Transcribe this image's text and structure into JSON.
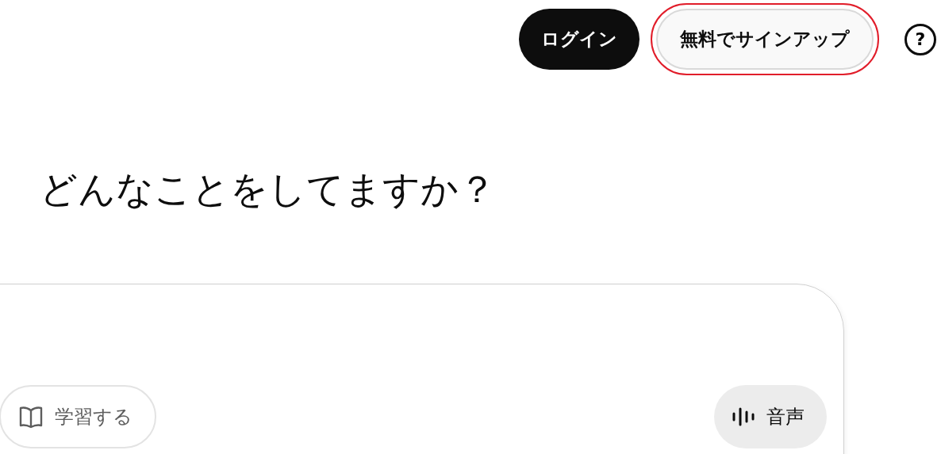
{
  "header": {
    "buttons": [
      {
        "label": "ログイン",
        "kind": "primary",
        "highlighted": false
      },
      {
        "label": "無料でサインアップ",
        "kind": "secondary",
        "highlighted": true
      }
    ],
    "help_button": "?"
  },
  "heading": "どんなことをしてますか？",
  "composer": {
    "tools": [
      {
        "label": "学習する",
        "kind": "study"
      },
      {
        "label": "音声",
        "kind": "voice"
      }
    ]
  }
}
